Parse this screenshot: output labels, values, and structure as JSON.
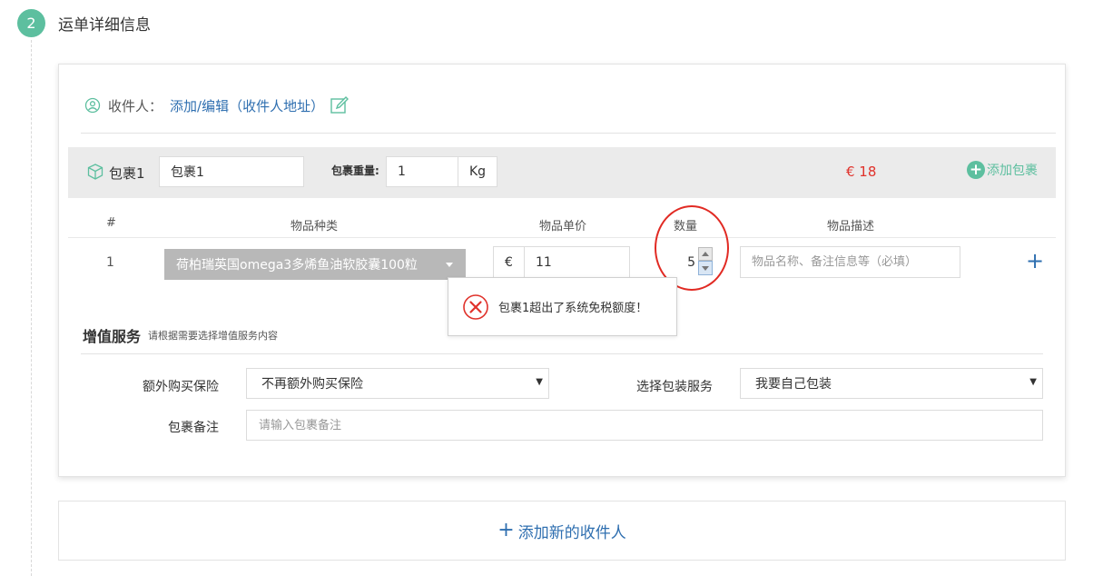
{
  "step": {
    "number": "2",
    "title": "运单详细信息"
  },
  "recipient": {
    "label": "收件人：",
    "link": "添加/编辑（收件人地址）"
  },
  "package": {
    "label": "包裹1",
    "name_value": "包裹1",
    "weight_label": "包裹重量:",
    "weight_value": "1",
    "weight_unit": "Kg",
    "price": "€ 18",
    "add_package_label": "添加包裹"
  },
  "items_table": {
    "columns": [
      "#",
      "物品种类",
      "物品单价",
      "数量",
      "物品描述"
    ],
    "rows": [
      {
        "index": "1",
        "category": "荷柏瑞英国omega3多烯鱼油软胶囊100粒",
        "currency": "€",
        "price": "11",
        "quantity": "5",
        "description_placeholder": "物品名称、备注信息等（必填）"
      }
    ]
  },
  "error_tooltip": {
    "message": "包裹1超出了系统免税额度！"
  },
  "value_added_services": {
    "title": "增值服务",
    "hint": "请根据需要选择增值服务内容",
    "insurance_label": "额外购买保险",
    "insurance_value": "不再额外购买保险",
    "packing_label": "选择包装服务",
    "packing_value": "我要自己包装",
    "note_label": "包裹备注",
    "note_placeholder": "请输入包裹备注"
  },
  "add_recipient_label": "添加新的收件人",
  "colors": {
    "accent_green": "#5dbf9f",
    "link_blue": "#2f6fb0",
    "price_red": "#e0322b",
    "highlight_red": "#e12a23"
  }
}
